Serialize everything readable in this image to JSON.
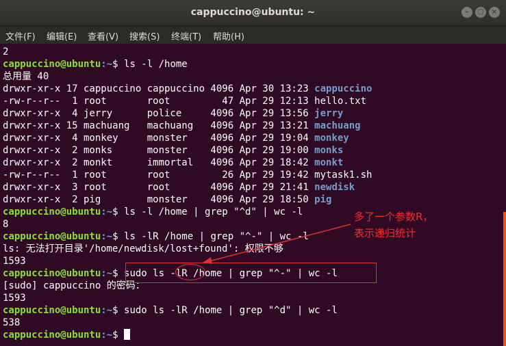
{
  "window": {
    "title": "cappuccino@ubuntu: ~",
    "buttons": [
      "–",
      "▢",
      "×"
    ]
  },
  "menu": [
    "文件(F)",
    "编辑(E)",
    "查看(V)",
    "搜索(S)",
    "终端(T)",
    "帮助(H)"
  ],
  "prompt": {
    "user": "cappuccino@ubuntu",
    "path": ":~",
    "symbol": "$"
  },
  "lines": {
    "l0": "2",
    "cmd1": " ls -l /home",
    "total": "总用量 40",
    "ls": [
      {
        "prefix": "drwxr-xr-x 17 cappuccino cappuccino 4096 Apr 30 13:23 ",
        "name": "cappuccino"
      },
      {
        "prefix": "-rw-r--r--  1 root       root         47 Apr 29 12:13 ",
        "name": "hello.txt"
      },
      {
        "prefix": "drwxr-xr-x  4 jerry      police     4096 Apr 29 13:56 ",
        "name": "jerry"
      },
      {
        "prefix": "drwxr-xr-x 15 machuang   machuang   4096 Apr 29 13:21 ",
        "name": "machuang"
      },
      {
        "prefix": "drwxr-xr-x  4 monkey     monster    4096 Apr 29 19:04 ",
        "name": "monkey"
      },
      {
        "prefix": "drwxr-xr-x  2 monks      monster    4096 Apr 29 19:00 ",
        "name": "monks"
      },
      {
        "prefix": "drwxr-xr-x  2 monkt      immortal   4096 Apr 29 18:42 ",
        "name": "monkt"
      },
      {
        "prefix": "-rw-r--r--  1 root       root         26 Apr 29 19:42 ",
        "name": "mytask1.sh"
      },
      {
        "prefix": "drwxr-xr-x  3 root       root       4096 Apr 29 21:41 ",
        "name": "newdisk"
      },
      {
        "prefix": "drwxr-xr-x  2 pig        monster    4096 Apr 29 18:50 ",
        "name": "pig"
      }
    ],
    "cmd2": " ls -l /home | grep \"^d\" | wc -l",
    "out2": "8",
    "cmd3": " ls -lR /home | grep \"^-\" | wc -l",
    "err3": "ls: 无法打开目录'/home/newdisk/lost+found': 权限不够",
    "out3": "1593",
    "cmd4": " sudo ls -lR /home | grep \"^-\" | wc -l",
    "sudo": "[sudo] cappuccino 的密码：",
    "out4": "1593",
    "cmd5": " sudo ls -lR /home | grep \"^d\" | wc -l",
    "out5": "538"
  },
  "annotation": {
    "line1": "多了一个参数R，",
    "line2": "表示递归统计"
  }
}
